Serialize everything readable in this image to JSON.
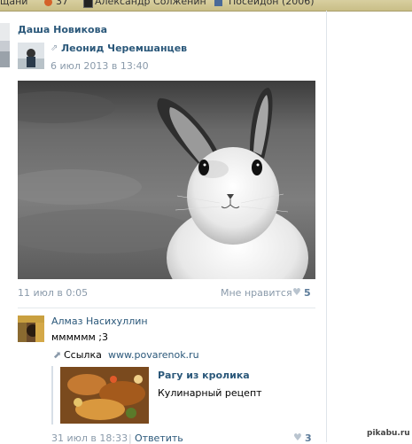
{
  "browser": {
    "bookmarks": [
      "щани",
      "37",
      "Александр Солженин",
      "Посейдон (2006)"
    ]
  },
  "post": {
    "author": "Даша Новикова",
    "repost_author": "Леонид Черемшанцев",
    "repost_date": "6 июл 2013 в 13:40",
    "date": "11 июл в 0:05",
    "like_label": "Мне нравится",
    "like_count": "5"
  },
  "comment": {
    "author": "Алмаз Насихуллин",
    "text": "мммммм ;3",
    "link_prefix": "Ссылка",
    "link_url": "www.povarenok.ru",
    "card_title": "Рагу из кролика",
    "card_subtitle": "Кулинарный рецепт",
    "date": "31 июл в 18:33",
    "separator": "|",
    "reply_label": "Ответить",
    "like_count": "3"
  },
  "watermark": "pikabu.ru",
  "colors": {
    "link": "#2b587a",
    "meta": "#8a9aaa",
    "divider": "#dfe4ea"
  }
}
